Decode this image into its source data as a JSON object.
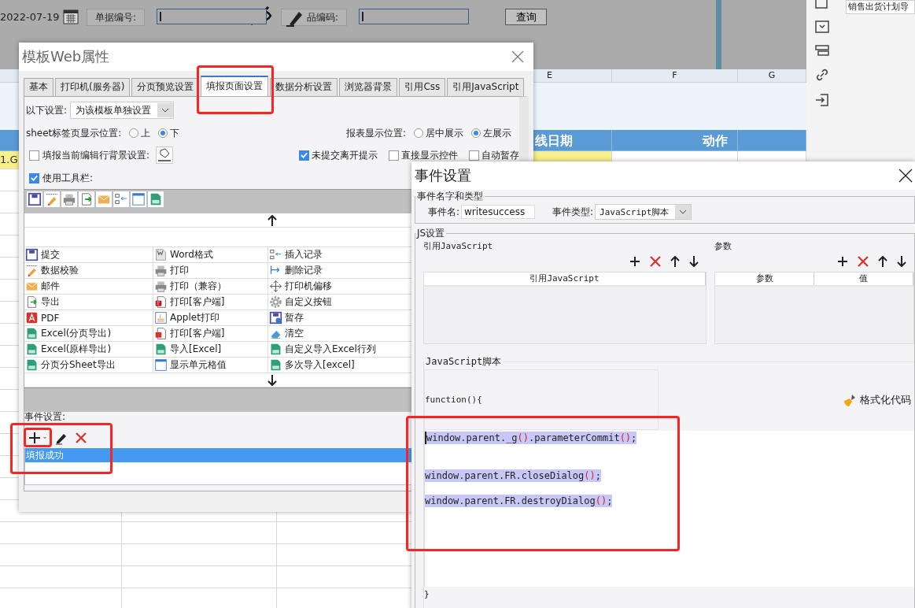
{
  "toolbar": {
    "date": "2022-07-19",
    "fields": [
      {
        "label": "单据编号:"
      },
      {
        "label": "品编码:"
      }
    ],
    "button": "查询"
  },
  "sheet": {
    "columns": [
      "E",
      "F",
      "G"
    ],
    "header": [
      "线日期",
      "动作"
    ],
    "row": [
      "1.G"
    ]
  },
  "side_panel": {
    "field_value": "销售出货计划导"
  },
  "web_dialog": {
    "title": "模板Web属性",
    "tabs": [
      {
        "label": "基本",
        "selected": false
      },
      {
        "label": "打印机(服务器)",
        "selected": false
      },
      {
        "label": "分页预览设置",
        "selected": false
      },
      {
        "label": "填报页面设置",
        "selected": true
      },
      {
        "label": "数据分析设置",
        "selected": false
      },
      {
        "label": "浏览器背景",
        "selected": false
      },
      {
        "label": "引用Css",
        "selected": false
      },
      {
        "label": "引用JavaScript",
        "selected": false
      }
    ],
    "scope_label": "以下设置:",
    "scope_value": "为该模板单独设置",
    "radio_groups": [
      {
        "label": "sheet标签页显示位置:",
        "options": [
          {
            "label": "上",
            "selected": false
          },
          {
            "label": "下",
            "selected": true
          }
        ]
      },
      {
        "label": "报表显示位置:",
        "options": [
          {
            "label": "居中展示",
            "selected": false
          },
          {
            "label": "左展示",
            "selected": true
          }
        ]
      }
    ],
    "row_background": {
      "label": "填报当前编辑行背景设置:",
      "checked": false
    },
    "checks": [
      {
        "label": "未提交离开提示",
        "checked": true
      },
      {
        "label": "直接显示控件",
        "checked": false
      },
      {
        "label": "自动暂存",
        "checked": false
      }
    ],
    "use_toolbar": {
      "label": "使用工具栏:",
      "checked": true
    },
    "toolbar_icons": [
      {
        "kind": "save"
      },
      {
        "kind": "pencil"
      },
      {
        "kind": "printer"
      },
      {
        "kind": "export"
      },
      {
        "kind": "mail"
      },
      {
        "kind": "insert"
      },
      {
        "kind": "window"
      },
      {
        "kind": "excel"
      }
    ],
    "options": [
      {
        "label": "提交",
        "kind": "save"
      },
      {
        "label": "Word格式",
        "kind": "word"
      },
      {
        "label": "插入记录",
        "kind": "insert"
      },
      {
        "label": "数据校验",
        "kind": "pencil"
      },
      {
        "label": "打印",
        "kind": "printer"
      },
      {
        "label": "删除记录",
        "kind": "delete"
      },
      {
        "label": "邮件",
        "kind": "mail"
      },
      {
        "label": "打印（兼容）",
        "kind": "printer"
      },
      {
        "label": "打印机偏移",
        "kind": "move"
      },
      {
        "label": "导出",
        "kind": "export"
      },
      {
        "label": "打印[客户端]",
        "kind": "flash"
      },
      {
        "label": "自定义按钮",
        "kind": "gear"
      },
      {
        "label": "PDF",
        "kind": "pdf"
      },
      {
        "label": "Applet打印",
        "kind": "applet"
      },
      {
        "label": "暂存",
        "kind": "savetime"
      },
      {
        "label": "Excel(分页导出)",
        "kind": "excel"
      },
      {
        "label": "打印[客户端]",
        "kind": "pdfdoc"
      },
      {
        "label": "清空",
        "kind": "eraser"
      },
      {
        "label": "Excel(原样导出)",
        "kind": "excel"
      },
      {
        "label": "导入[Excel]",
        "kind": "excel"
      },
      {
        "label": "自定义导入Excel行列",
        "kind": "excel"
      },
      {
        "label": "分页分Sheet导出",
        "kind": "excel"
      },
      {
        "label": "显示单元格值",
        "kind": "window"
      },
      {
        "label": "多次导入[excel]",
        "kind": "excel"
      }
    ],
    "event_label": "事件设置:",
    "events": [
      {
        "label": "填报成功",
        "selected": true
      }
    ]
  },
  "event_dialog": {
    "title": "事件设置",
    "name_group": {
      "title": "事件名字和类型",
      "name_label": "事件名:",
      "name_value": "writesuccess",
      "type_label": "事件类型:",
      "type_value": "JavaScript脚本"
    },
    "js_group": {
      "title": "JS设置",
      "refs": {
        "title": "引用JavaScript",
        "columns": [
          "引用JavaScript"
        ]
      },
      "params": {
        "title": "参数",
        "columns": [
          "参数",
          "值"
        ]
      },
      "script": {
        "title": "JavaScript脚本",
        "header": "function(){",
        "format_button": "格式化代码",
        "lines": [
          {
            "selected": true,
            "tokens": [
              {
                "text": "window.parent._g",
                "kind": "plain"
              },
              {
                "text": "()",
                "kind": "paren"
              },
              {
                "text": ".parameterCommit",
                "kind": "plain"
              },
              {
                "text": "()",
                "kind": "paren"
              },
              {
                "text": ";",
                "kind": "plain"
              }
            ]
          },
          {
            "selected": true,
            "tokens": [
              {
                "text": "window.parent.FR.closeDialog",
                "kind": "plain"
              },
              {
                "text": "()",
                "kind": "paren"
              },
              {
                "text": ";",
                "kind": "plain"
              }
            ]
          },
          {
            "selected": true,
            "tokens": [
              {
                "text": "window.parent.FR.destroyDialog",
                "kind": "plain"
              },
              {
                "text": "()",
                "kind": "paren"
              },
              {
                "text": ";",
                "kind": "plain"
              }
            ]
          }
        ],
        "footer": "}"
      }
    }
  }
}
